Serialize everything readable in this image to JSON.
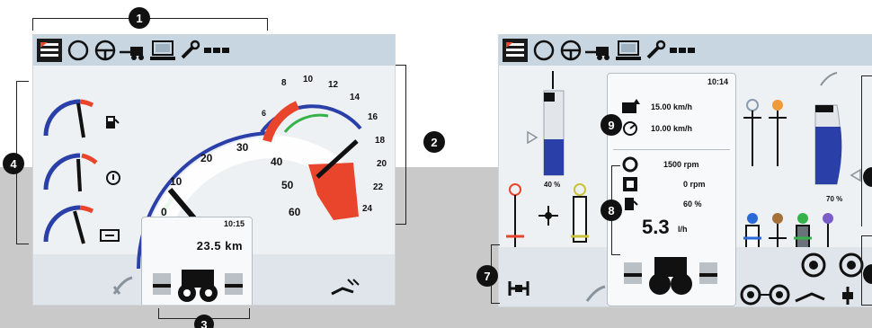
{
  "callouts": [
    "1",
    "2",
    "3",
    "4",
    "7",
    "8",
    "9"
  ],
  "left_screen": {
    "speed_ticks": [
      "0",
      "10",
      "20",
      "30",
      "40",
      "50",
      "60"
    ],
    "rpm_ticks": [
      "6",
      "8",
      "10",
      "12",
      "14",
      "16",
      "18",
      "20",
      "22",
      "24"
    ],
    "odo_time": "10:15",
    "odo_distance": "23.5 km",
    "toolbar_icons": [
      "menu-icon",
      "circle-icon",
      "steering-wheel-icon",
      "implement-icon",
      "computer-icon",
      "wrench-icon",
      "service-icon"
    ]
  },
  "right_screen": {
    "time": "10:14",
    "speed_1": "15.00 km/h",
    "speed_2": "10.00 km/h",
    "engine_rpm": "1500 rpm",
    "pto_rpm": "0 rpm",
    "fuel_percent": "60 %",
    "fuel_rate": "5.3",
    "fuel_rate_unit": "l/h",
    "left_gauge_percent": "40 %",
    "right_gauge_percent": "70 %"
  },
  "colors": {
    "toolbar": "#c8d6e1",
    "screen_bg": "#eef1f4",
    "gauge_red": "#e8452c",
    "gauge_blue": "#2a3fa8",
    "gauge_green": "#36b24a",
    "callout": "#111111"
  }
}
